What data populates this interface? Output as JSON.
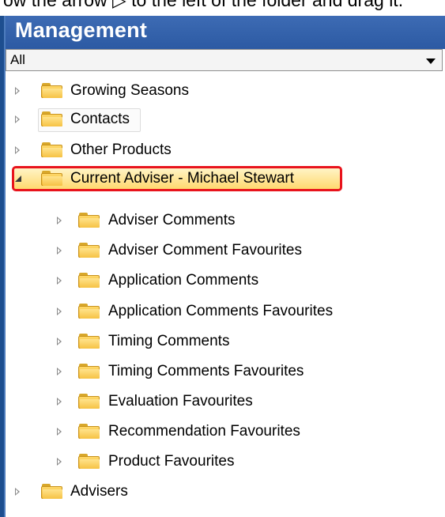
{
  "top_cut_text": "ow the arrow ▷ to the left of the folder and drag it.",
  "panel": {
    "title": "Management"
  },
  "filter": {
    "selected": "All"
  },
  "tree": [
    {
      "label": "Growing Seasons",
      "level": 0,
      "expanded": false
    },
    {
      "label": "Contacts",
      "level": 0,
      "expanded": false
    },
    {
      "label": "Other Products",
      "level": 0,
      "expanded": false
    },
    {
      "label": "Current Adviser - Michael Stewart",
      "level": 0,
      "expanded": true,
      "selected": true
    },
    {
      "label": "Adviser Comments",
      "level": 1,
      "expanded": false
    },
    {
      "label": "Adviser Comment Favourites",
      "level": 1,
      "expanded": false
    },
    {
      "label": "Application Comments",
      "level": 1,
      "expanded": false
    },
    {
      "label": "Application Comments Favourites",
      "level": 1,
      "expanded": false
    },
    {
      "label": "Timing Comments",
      "level": 1,
      "expanded": false
    },
    {
      "label": "Timing Comments Favourites",
      "level": 1,
      "expanded": false
    },
    {
      "label": "Evaluation Favourites",
      "level": 1,
      "expanded": false
    },
    {
      "label": "Recommendation Favourites",
      "level": 1,
      "expanded": false
    },
    {
      "label": "Product Favourites",
      "level": 1,
      "expanded": false
    },
    {
      "label": "Advisers",
      "level": 0,
      "expanded": false
    }
  ],
  "colors": {
    "header": "#2c5aa3",
    "highlight_border": "#e8131c",
    "folder": "#f0b52f"
  }
}
